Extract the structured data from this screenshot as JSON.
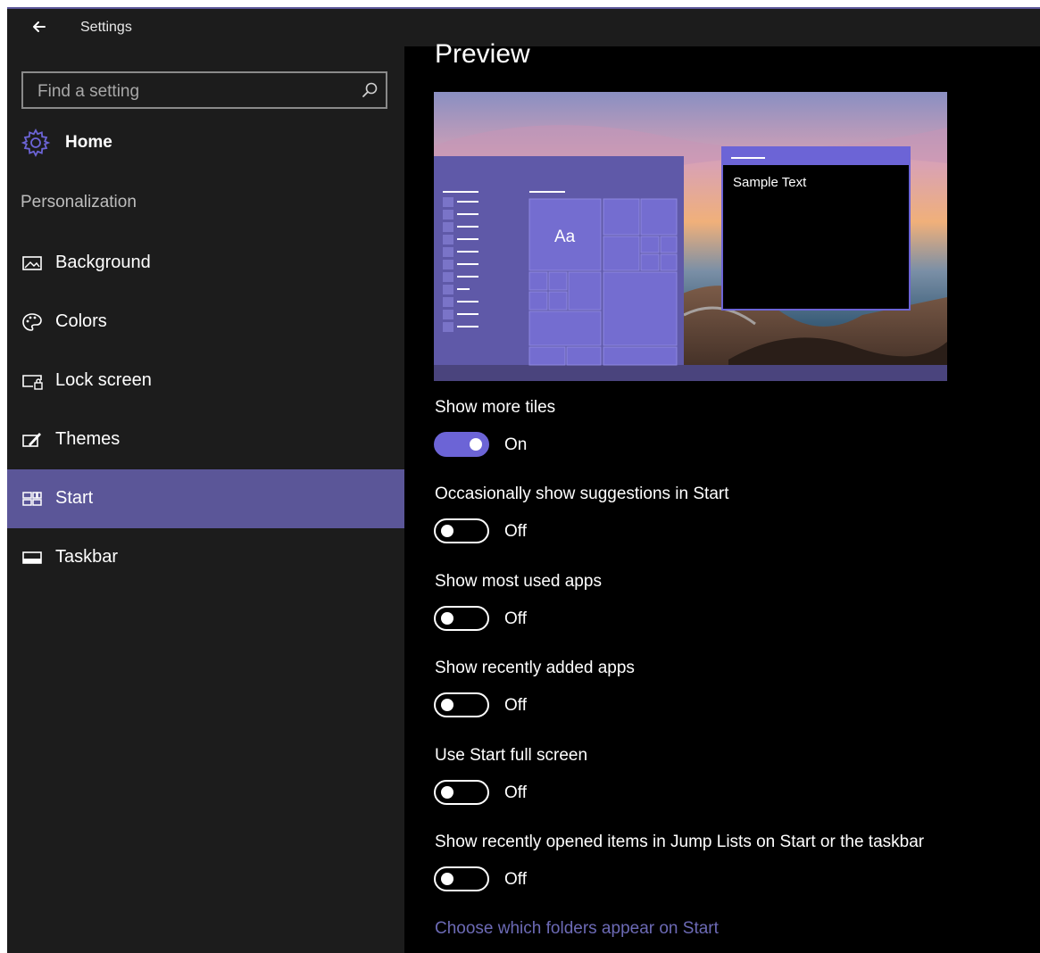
{
  "window": {
    "title": "Settings"
  },
  "search": {
    "placeholder": "Find a setting"
  },
  "home": {
    "label": "Home"
  },
  "sidebar": {
    "section": "Personalization",
    "items": [
      {
        "label": "Background",
        "icon": "image-icon"
      },
      {
        "label": "Colors",
        "icon": "palette-icon"
      },
      {
        "label": "Lock screen",
        "icon": "lock-screen-icon"
      },
      {
        "label": "Themes",
        "icon": "themes-icon"
      },
      {
        "label": "Start",
        "icon": "start-icon",
        "selected": true
      },
      {
        "label": "Taskbar",
        "icon": "taskbar-icon"
      }
    ]
  },
  "main": {
    "preview_title": "Preview",
    "preview": {
      "tile_text": "Aa",
      "window_text": "Sample Text"
    },
    "settings": [
      {
        "label": "Show more tiles",
        "state": "On",
        "on": true
      },
      {
        "label": "Occasionally show suggestions in Start",
        "state": "Off",
        "on": false
      },
      {
        "label": "Show most used apps",
        "state": "Off",
        "on": false
      },
      {
        "label": "Show recently added apps",
        "state": "Off",
        "on": false
      },
      {
        "label": "Use Start full screen",
        "state": "Off",
        "on": false
      },
      {
        "label": "Show recently opened items in Jump Lists on Start or the taskbar",
        "state": "Off",
        "on": false
      }
    ],
    "link": "Choose which folders appear on Start"
  },
  "colors": {
    "accent": "#5b5698",
    "toggle_on": "#6c64d6",
    "link": "#6c6ab5",
    "sidebar_bg": "#1c1c1c",
    "content_bg": "#000000"
  }
}
